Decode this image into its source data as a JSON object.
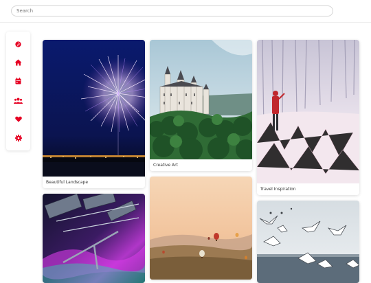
{
  "search": {
    "placeholder": "Search"
  },
  "sidebar": {
    "items": [
      {
        "icon": "pinterest-icon"
      },
      {
        "icon": "home-icon"
      },
      {
        "icon": "calendar-icon"
      },
      {
        "icon": "users-icon"
      },
      {
        "icon": "heart-icon"
      },
      {
        "icon": "gear-icon"
      }
    ],
    "accent": "#e60023"
  },
  "cards": [
    {
      "caption": "Beautiful Landscape",
      "image": "fireworks over night city"
    },
    {
      "caption": "",
      "image": "space station over aurora"
    },
    {
      "caption": "Creative Art",
      "image": "castle on forested hill"
    },
    {
      "caption": "",
      "image": "hot air balloons over valley"
    },
    {
      "caption": "Travel Inspiration",
      "image": "person in red coat in snowy forest"
    },
    {
      "caption": "",
      "image": "seagulls over the sea"
    }
  ]
}
